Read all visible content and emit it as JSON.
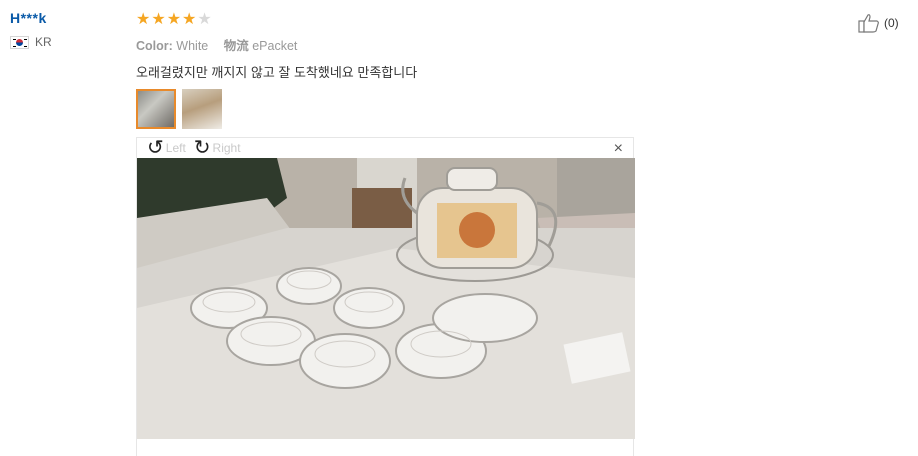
{
  "reviewer": {
    "name": "H***k",
    "country_code": "KR"
  },
  "rating": {
    "value": 4,
    "max": 5
  },
  "attributes": [
    {
      "key": "Color:",
      "value": "White"
    },
    {
      "key": "物流",
      "value": "ePacket"
    }
  ],
  "review_text": "오래걸렸지만 깨지지 않고 잘 도착했네요 만족합니다",
  "thumbnails": [
    "photo-1",
    "photo-2"
  ],
  "viewer": {
    "rotate_left_label": "Left",
    "rotate_right_label": "Right",
    "close_glyph": "×",
    "photo_icon": "teapot-set-photo"
  },
  "helpful": {
    "icon": "thumbs-up-icon",
    "count": "(0)"
  },
  "colors": {
    "star": "#f5a623",
    "username": "#0a5aa8",
    "active_thumb": "#e88a2b"
  }
}
